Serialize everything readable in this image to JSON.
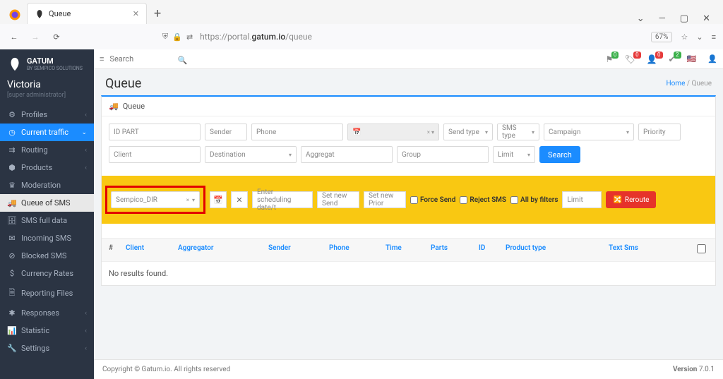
{
  "browser": {
    "tab_title": "Queue",
    "url_prefix": "https://portal.",
    "url_domain": "gatum.io",
    "url_path": "/queue",
    "zoom": "67%"
  },
  "brand": {
    "name": "GATUM",
    "sub": "BY SEMPICO SOLUTIONS"
  },
  "user": {
    "name": "Victoria",
    "role": "[super administrator]"
  },
  "sidebar": {
    "items": [
      {
        "label": "Profiles"
      },
      {
        "label": "Current traffic"
      },
      {
        "label": "Routing"
      },
      {
        "label": "Products"
      },
      {
        "label": "Moderation"
      },
      {
        "label": "Queue of SMS"
      },
      {
        "label": "SMS full data"
      },
      {
        "label": "Incoming SMS"
      },
      {
        "label": "Blocked SMS"
      },
      {
        "label": "Currency Rates"
      },
      {
        "label": "Reporting Files"
      },
      {
        "label": "Responses"
      },
      {
        "label": "Statistic"
      },
      {
        "label": "Settings"
      }
    ]
  },
  "topbar": {
    "search_placeholder": "Search",
    "badges": [
      "0",
      "0",
      "0",
      "2"
    ]
  },
  "page": {
    "title": "Queue",
    "bc_home": "Home",
    "bc_sep": " / ",
    "bc_cur": "Queue",
    "panel_title": "Queue"
  },
  "filters": {
    "id_part": "ID PART",
    "sender": "Sender",
    "phone": "Phone",
    "send_type": "Send type",
    "sms_type": "SMS type",
    "campaign": "Campaign",
    "priority": "Priority",
    "client": "Client",
    "destination": "Destination",
    "aggregat": "Aggregat",
    "group": "Group",
    "limit": "Limit",
    "search_btn": "Search",
    "x_caret": "× ▾"
  },
  "reroute": {
    "selected": "Sempico_DIR",
    "sched_placeholder": "Enter scheduling date/t",
    "set_send": "Set new Send",
    "set_prior": "Set new Prior",
    "force_send": "Force Send",
    "reject_sms": "Reject SMS",
    "all_by_filters": "All by filters",
    "limit": "Limit",
    "reroute_btn": "Reroute"
  },
  "table": {
    "hash": "#",
    "client": "Client",
    "aggregator": "Aggregator",
    "sender": "Sender",
    "phone": "Phone",
    "time": "Time",
    "parts": "Parts",
    "id": "ID",
    "product_type": "Product type",
    "text_sms": "Text Sms",
    "no_results": "No results found."
  },
  "footer": {
    "copyright": "Copyright © Gatum.io. All rights reserved",
    "version_label": "Version ",
    "version": "7.0.1"
  }
}
